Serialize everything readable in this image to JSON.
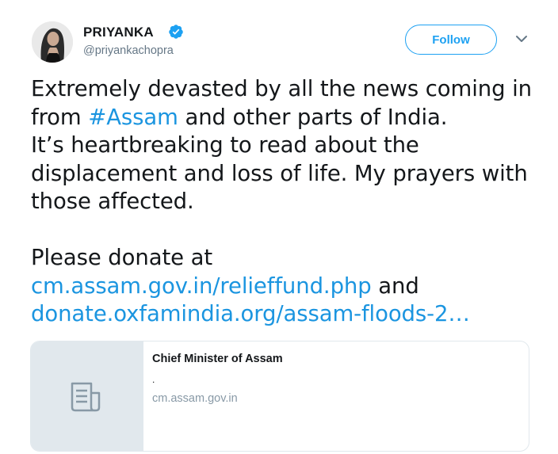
{
  "author": {
    "display_name": "PRIYANKA",
    "handle": "@priyankachopra",
    "verified": true,
    "follow_label": "Follow"
  },
  "tweet": {
    "line1": "Extremely devasted by all the news coming in",
    "line2_prefix": "from ",
    "hashtag": "#Assam",
    "line2_suffix": " and other parts of India.",
    "line3": "It’s heartbreaking to read about the",
    "line4": "displacement and loss of life. My prayers with",
    "line5": "those affected.",
    "line6": "Please donate at",
    "link1": "cm.assam.gov.in/relieffund.php",
    "link_joiner": " and",
    "link2": "donate.oxfamindia.org/assam-floods-2…"
  },
  "card": {
    "title": "Chief Minister of Assam",
    "description": ".",
    "domain": "cm.assam.gov.in",
    "thumbnail_icon": "document-icon"
  },
  "colors": {
    "accent": "#1da1f2",
    "link": "#1b95e0",
    "muted": "#657786",
    "card_border": "#e1e8ed"
  }
}
